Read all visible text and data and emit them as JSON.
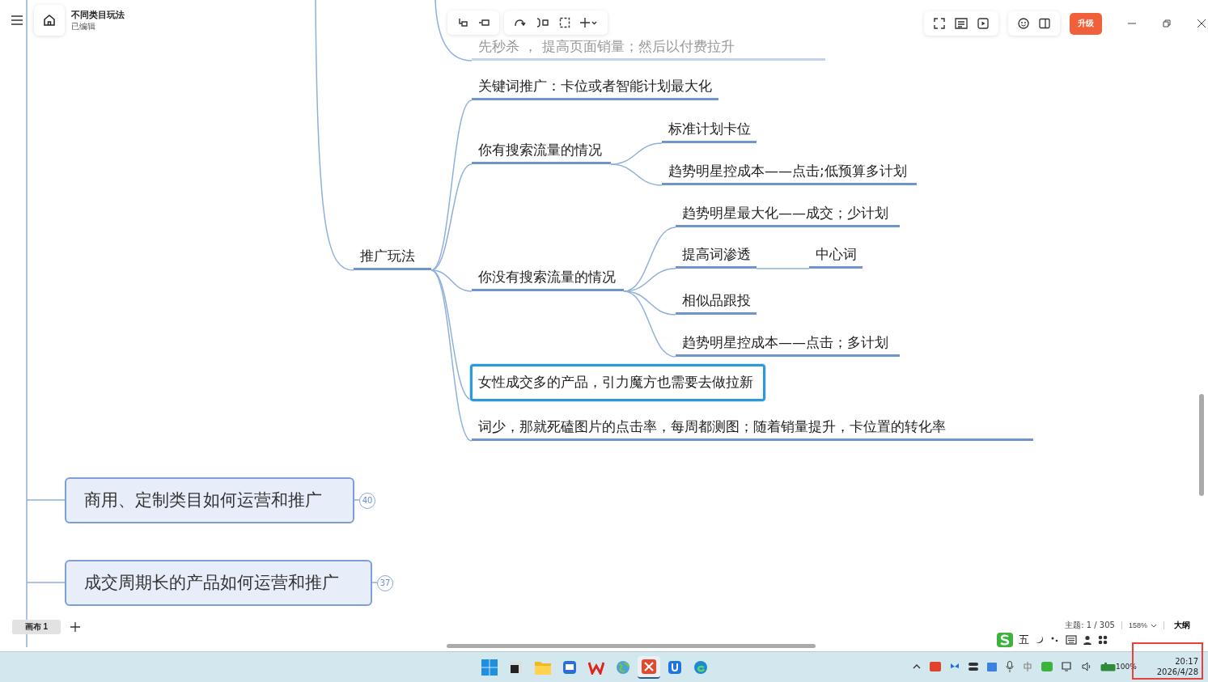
{
  "app": {
    "title": "不同类目玩法",
    "status": "已编辑"
  },
  "upgrade_button": "升级",
  "nodes": [
    {
      "text": "先秒杀 ， 提高页面销量；然后以付费拉升",
      "kind": "faded"
    },
    {
      "text": "关键词推广：卡位或者智能计划最大化",
      "kind": "plain"
    },
    {
      "text": "你有搜索流量的情况",
      "kind": "plain"
    },
    {
      "text": "标准计划卡位",
      "kind": "plain"
    },
    {
      "text": "趋势明星控成本——点击;低预算多计划",
      "kind": "plain"
    },
    {
      "text": "推广玩法",
      "kind": "plain"
    },
    {
      "text": "你没有搜索流量的情况",
      "kind": "plain"
    },
    {
      "text": "趋势明星最大化——成交；少计划",
      "kind": "plain"
    },
    {
      "text": "提高词渗透",
      "kind": "plain"
    },
    {
      "text": "中心词",
      "kind": "plain"
    },
    {
      "text": "相似品跟投",
      "kind": "plain"
    },
    {
      "text": "趋势明星控成本——点击；多计划",
      "kind": "plain"
    },
    {
      "text": "女性成交多的产品，引力魔方也需要去做拉新",
      "kind": "selected"
    },
    {
      "text": "词少，那就死磕图片的点击率，每周都测图；随着销量提升，卡位置的转化率",
      "kind": "plain"
    }
  ],
  "topics": [
    {
      "text": "商用、定制类目如何运营和推广",
      "count": "40"
    },
    {
      "text": "成交周期长的产品如何运营和推广",
      "count": "37"
    }
  ],
  "canvas_tabs": [
    {
      "label": "画布 1",
      "selected": true
    }
  ],
  "status": {
    "topics": "主题: 1 / 305",
    "zoom": "158%",
    "outline": "大纲"
  },
  "ime": {
    "mode": "五"
  },
  "taskbar": {
    "battery": "100%",
    "time": "20:17",
    "date": "2026/4/28"
  }
}
